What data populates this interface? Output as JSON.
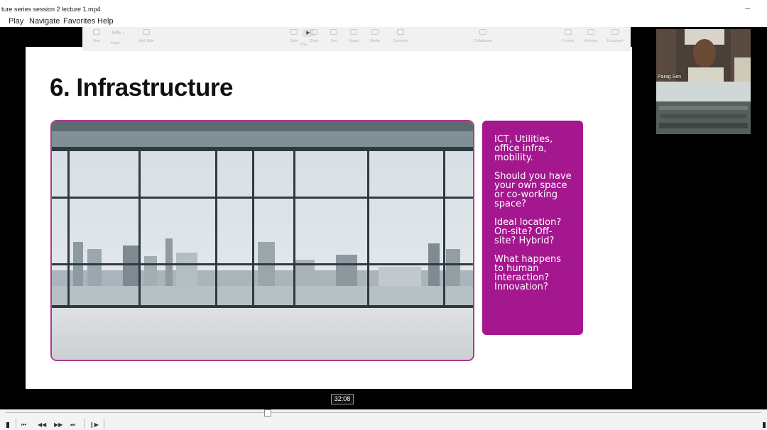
{
  "window": {
    "title": "ture series session 2 lecture 1.mp4",
    "minimize": "–"
  },
  "menu": [
    "Play",
    "Navigate",
    "Favorites",
    "Help"
  ],
  "keynote_toolbar": {
    "left_items": [
      "View",
      "Zoom",
      "Add Slide"
    ],
    "zoom_value": "54% ⌄",
    "play_label": "Play",
    "middle_items": [
      "Table",
      "Chart",
      "Text",
      "Shape",
      "Media",
      "Comment"
    ],
    "collaborate_label": "Collaborate",
    "right_items": [
      "Format",
      "Animate",
      "Document"
    ]
  },
  "slide": {
    "title": "6. Infrastructure",
    "photo_description_icon": "office-window-city-photo",
    "text_paragraphs": [
      "ICT, Utilities, office infra, mobility.",
      "Should you have your own space or co-working space?",
      "Ideal location? On-site? Off-site? Hybrid?",
      "What happens to human interaction? Innovation?"
    ],
    "accent_color": "#a4178f"
  },
  "participants": [
    {
      "name": "Parag Sen"
    },
    {
      "name": ""
    }
  ],
  "player": {
    "timestamp": "32:08",
    "controls": [
      "⏮",
      "◀◀",
      "▶▶",
      "⏭",
      "❙▶"
    ]
  }
}
